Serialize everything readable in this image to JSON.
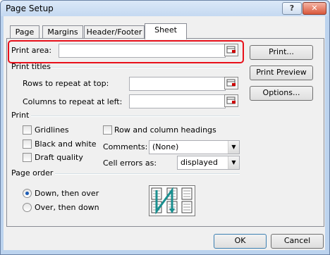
{
  "window": {
    "title": "Page Setup"
  },
  "tabs": [
    "Page",
    "Margins",
    "Header/Footer",
    "Sheet"
  ],
  "print_area": {
    "label": "Print area:",
    "value": ""
  },
  "side_buttons": {
    "print": "Print...",
    "print_preview": "Print Preview",
    "options": "Options..."
  },
  "print_titles": {
    "heading": "Print titles",
    "rows_label": "Rows to repeat at top:",
    "cols_label": "Columns to repeat at left:"
  },
  "print_section": {
    "heading": "Print",
    "gridlines": "Gridlines",
    "black_white": "Black and white",
    "draft_quality": "Draft quality",
    "row_col_headings": "Row and column headings",
    "comments_label": "Comments:",
    "comments_value": "(None)",
    "cell_errors_label": "Cell errors as:",
    "cell_errors_value": "displayed"
  },
  "page_order": {
    "heading": "Page order",
    "down_then_over": "Down, then over",
    "over_then_down": "Over, then down"
  },
  "footer": {
    "ok": "OK",
    "cancel": "Cancel"
  },
  "colors": {
    "highlight": "#e8101a",
    "accent": "#1c5cb5"
  }
}
